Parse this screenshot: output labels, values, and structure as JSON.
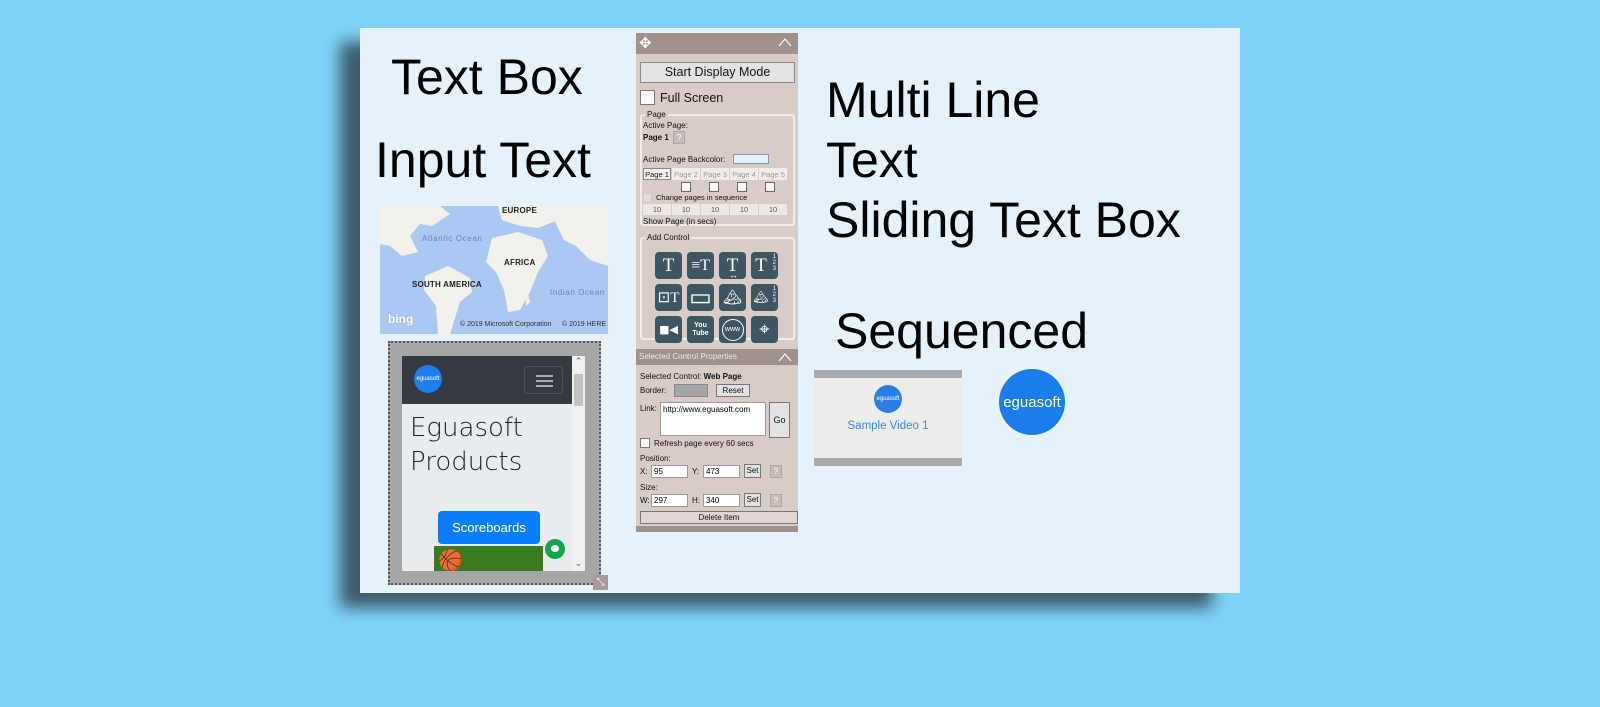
{
  "canvas": {
    "labels": {
      "text_box": "Text Box",
      "input_text": "Input Text",
      "multi_line": "Multi Line\nText\nSliding Text Box",
      "sequenced": "Sequenced"
    },
    "background_color": "#e5f2fc"
  },
  "map": {
    "labels": {
      "europe": "EUROPE",
      "africa": "AFRICA",
      "south_america": "SOUTH AMERICA"
    },
    "oceans": {
      "atlantic": "Atlantic Ocean",
      "indian": "Indian Ocean"
    },
    "bing": "bing",
    "copyright_ms": "© 2019 Microsoft Corporation",
    "copyright_here": "© 2019 HERE"
  },
  "web_page": {
    "logo": "eguasoft",
    "title": "Eguasoft\nProducts",
    "button": "Scoreboards",
    "sports_icons": "🏀 🏏 🤾"
  },
  "video": {
    "logo": "eguasoft",
    "title": "Sample Video 1"
  },
  "sequenced_logo": "eguasoft",
  "toolbox": {
    "start_button": "Start Display Mode",
    "full_screen": "Full Screen",
    "page_group": {
      "legend": "Page",
      "active_page_label": "Active Page:",
      "active_page_value": "Page 1",
      "backcolor_label": "Active Page Backcolor:",
      "tabs": [
        "Page 1",
        "Page 2",
        "Page 3",
        "Page 4",
        "Page 5"
      ],
      "active_tab": "Page 1",
      "sequence_label": "Change pages in sequence",
      "seconds": [
        "10",
        "10",
        "10",
        "10",
        "10"
      ],
      "show_page_label": "Show Page (in secs)"
    },
    "add_control": {
      "legend": "Add Control",
      "tiles": [
        {
          "name": "text-box-tile",
          "glyph": "T",
          "sub": ""
        },
        {
          "name": "multi-line-text-tile",
          "glyph": "≡T",
          "sub": ""
        },
        {
          "name": "sliding-text-tile",
          "glyph": "T",
          "sub": "↔"
        },
        {
          "name": "sequenced-text-tile",
          "glyph": "T",
          "sub": "1\n2\n3"
        },
        {
          "name": "input-text-tile",
          "glyph": "⊡T",
          "sub": ""
        },
        {
          "name": "rectangle-tile",
          "glyph": "▭",
          "sub": ""
        },
        {
          "name": "image-tile",
          "glyph": "🏔",
          "sub": ""
        },
        {
          "name": "sequenced-image-tile",
          "glyph": "🏔",
          "sub": "1\n2\n3"
        },
        {
          "name": "video-tile",
          "glyph": "■◀",
          "sub": ""
        },
        {
          "name": "youtube-tile",
          "glyph": "You\nTube",
          "sub": ""
        },
        {
          "name": "web-page-tile",
          "glyph": "www",
          "sub": ""
        },
        {
          "name": "map-tile",
          "glyph": "⌖",
          "sub": ""
        }
      ]
    },
    "properties": {
      "header": "Selected Control Properties",
      "selected_label": "Selected Control:",
      "selected_value": "Web Page",
      "border_label": "Border:",
      "border_color": "#a6a6a6",
      "reset": "Reset",
      "link_label": "Link:",
      "link_value": "http://www.eguasoft.com",
      "go": "Go",
      "refresh_label": "Refresh page every 60 secs",
      "position_label": "Position:",
      "x_label": "X:",
      "x_value": "95",
      "y_label": "Y:",
      "y_value": "473",
      "set": "Set",
      "size_label": "Size:",
      "w_label": "W:",
      "w_value": "297",
      "h_label": "H:",
      "h_value": "340",
      "delete": "Delete Item"
    }
  },
  "colors": {
    "page_background": "#7fd3f7",
    "panel": "#d9ccc7",
    "panel_header": "#a0918c",
    "tile": "#3d5662",
    "brand_blue": "#1a7de9"
  }
}
